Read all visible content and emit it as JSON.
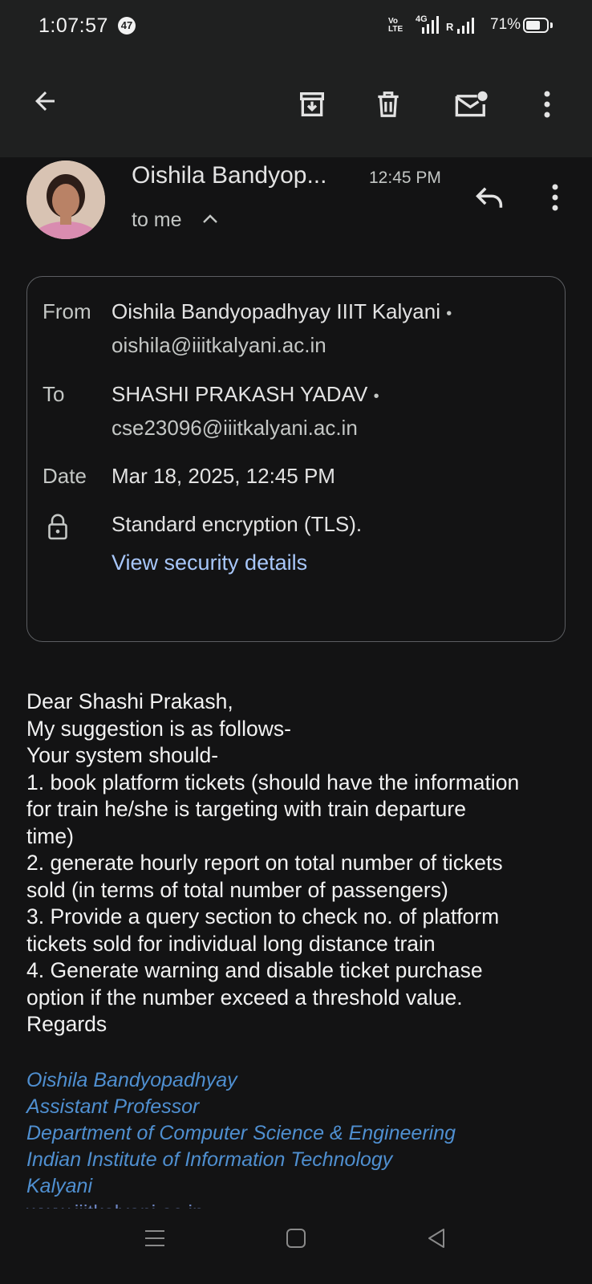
{
  "status_bar": {
    "time": "1:07:57",
    "notification_count": "47",
    "network_volte": "Vo LTE",
    "network_type": "4G",
    "roaming": "R",
    "battery_percent": "71%",
    "battery_level": 0.71
  },
  "toolbar": {
    "icons": [
      "back-arrow-icon",
      "archive-icon",
      "delete-icon",
      "mark-unread-icon",
      "more-vert-icon"
    ]
  },
  "message_header": {
    "sender_name": "Oishila Bandyop...",
    "time": "12:45 PM",
    "recipient_summary": "to me"
  },
  "details": {
    "from_label": "From",
    "from_name": "Oishila Bandyopadhyay IIIT Kalyani",
    "from_email": "oishila@iiitkalyani.ac.in",
    "to_label": "To",
    "to_name": "SHASHI PRAKASH YADAV",
    "to_email": "cse23096@iiitkalyani.ac.in",
    "date_label": "Date",
    "date_value": "Mar 18, 2025, 12:45 PM",
    "encryption": "Standard encryption (TLS).",
    "security_link": "View security details",
    "separator": "•"
  },
  "body": {
    "lines": [
      "Dear Shashi Prakash,",
      "My suggestion is as follows-",
      "Your system should-",
      "1. book platform tickets (should have the information",
      "for train he/she is targeting with train departure",
      "time)",
      "2. generate hourly report on total number of tickets",
      "sold (in terms of total number of passengers)",
      "3. Provide a query section to check no. of platform",
      "tickets sold for individual long distance train",
      "4. Generate warning and disable ticket purchase",
      "option if the number exceed a threshold value.",
      "Regards"
    ]
  },
  "signature": {
    "lines": [
      "Oishila Bandyopadhyay",
      "Assistant Professor",
      "Department of Computer Science & Engineering",
      "Indian Institute of Information Technology",
      "Kalyani"
    ],
    "website": "www.iiitkalyani.ac.in"
  },
  "colors": {
    "background": "#131314",
    "bar": "#1f2020",
    "link": "#a8c7fa",
    "signature": "#4f8fd0"
  }
}
